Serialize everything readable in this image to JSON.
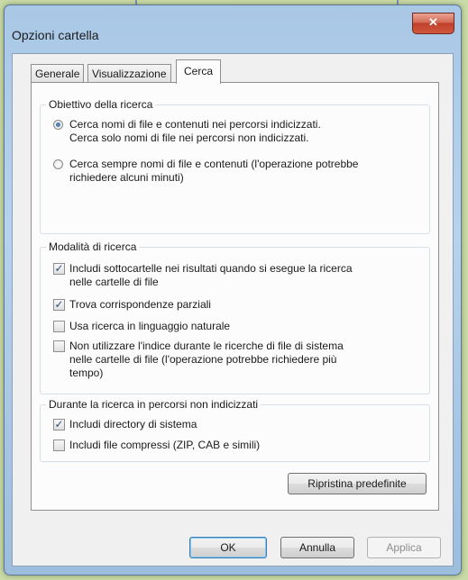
{
  "window": {
    "title": "Opzioni cartella",
    "close_label": "✕"
  },
  "tabs": [
    {
      "label": "Generale",
      "active": false
    },
    {
      "label": "Visualizzazione",
      "active": false
    },
    {
      "label": "Cerca",
      "active": true
    }
  ],
  "search_target": {
    "title": "Obiettivo della ricerca",
    "options": [
      {
        "line1": "Cerca nomi di file e contenuti nei percorsi indicizzati.",
        "line2": "Cerca solo nomi di file nei percorsi non indicizzati.",
        "selected": true
      },
      {
        "line1": "Cerca sempre nomi di file e contenuti (l'operazione potrebbe",
        "line2": "richiedere alcuni minuti)",
        "selected": false
      }
    ]
  },
  "search_mode": {
    "title": "Modalità di ricerca",
    "items": [
      {
        "line1": "Includi sottocartelle nei risultati quando si esegue la ricerca",
        "line2": "nelle cartelle di file",
        "line3": "",
        "checked": true
      },
      {
        "line1": "Trova corrispondenze parziali",
        "line2": "",
        "line3": "",
        "checked": true
      },
      {
        "line1": "Usa ricerca in linguaggio naturale",
        "line2": "",
        "line3": "",
        "checked": false
      },
      {
        "line1": "Non utilizzare l'indice durante le ricerche di file di sistema",
        "line2": "nelle cartelle di file (l'operazione potrebbe richiedere più",
        "line3": "tempo)",
        "checked": false
      }
    ]
  },
  "non_indexed": {
    "title": "Durante la ricerca in percorsi non indicizzati",
    "items": [
      {
        "label": "Includi directory di sistema",
        "checked": true
      },
      {
        "label": "Includi file compressi (ZIP, CAB e simili)",
        "checked": false
      }
    ]
  },
  "buttons": {
    "restore": "Ripristina predefinite",
    "ok": "OK",
    "cancel": "Annulla",
    "apply": "Applica"
  },
  "colors": {
    "background": "#c9dba6",
    "titlebar": "#a9c8e6",
    "close": "#c0402a"
  },
  "icons": {
    "check": "✓",
    "close": "close-icon"
  }
}
